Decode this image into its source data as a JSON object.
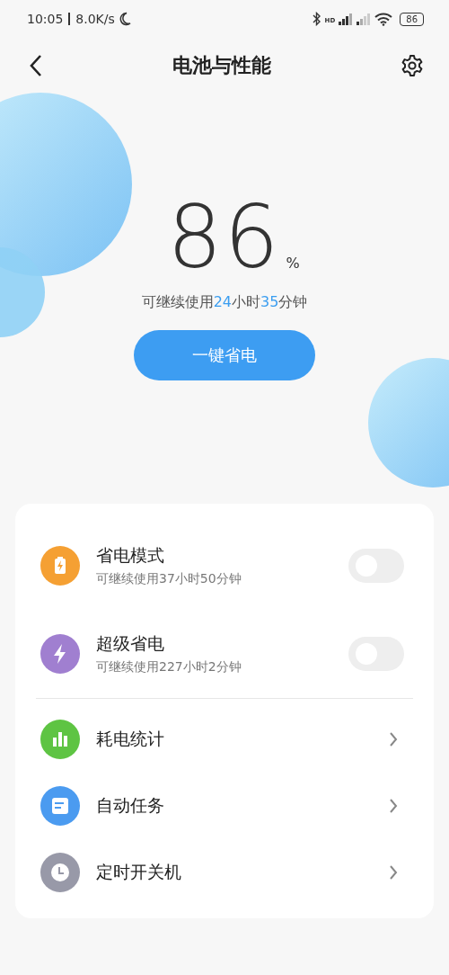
{
  "status_bar": {
    "time": "10:05",
    "speed": "8.0K/s",
    "network": "HD",
    "battery": "86"
  },
  "header": {
    "title": "电池与性能"
  },
  "battery": {
    "percent": "86",
    "unit": "%",
    "remaining": [
      {
        "text": "可继续使用",
        "highlight": false
      },
      {
        "text": "24",
        "highlight": true
      },
      {
        "text": "小时",
        "highlight": false
      },
      {
        "text": "35",
        "highlight": true
      },
      {
        "text": "分钟",
        "highlight": false
      }
    ],
    "button": "一键省电"
  },
  "items": [
    {
      "kind": "toggle",
      "color": "#f5a033",
      "title": "省电模式",
      "subtitle": "可继续使用37小时50分钟",
      "on": false
    },
    {
      "kind": "toggle",
      "color": "#a07fd0",
      "title": "超级省电",
      "subtitle": "可继续使用227小时2分钟",
      "on": false
    },
    {
      "kind": "divider"
    },
    {
      "kind": "link",
      "color": "#5ec443",
      "title": "耗电统计"
    },
    {
      "kind": "link",
      "color": "#4b9bf0",
      "title": "自动任务"
    },
    {
      "kind": "link",
      "color": "#9899a8",
      "title": "定时开关机"
    }
  ]
}
